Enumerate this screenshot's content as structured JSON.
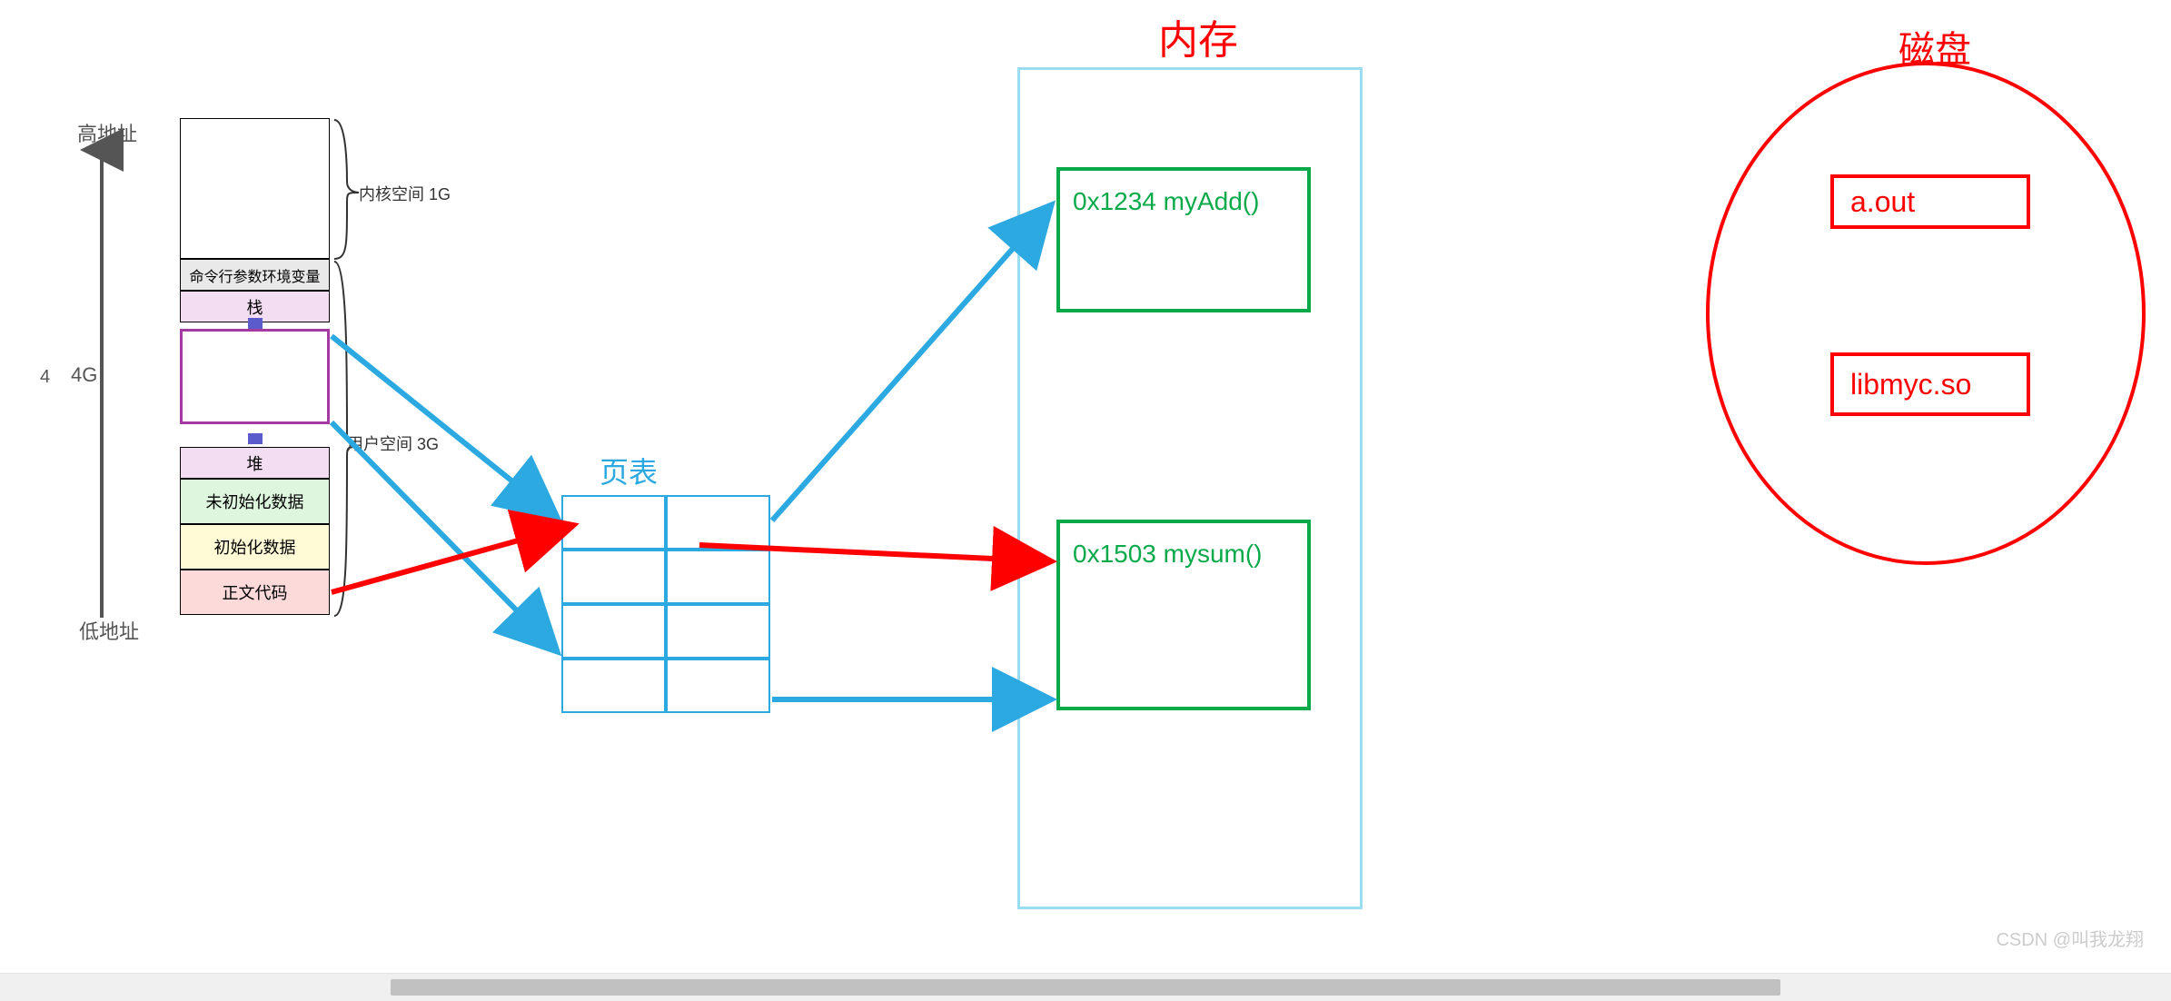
{
  "titles": {
    "memory": "内存",
    "disk": "磁盘",
    "page_table": "页表"
  },
  "address_labels": {
    "high": "高地址",
    "low": "低地址",
    "fourg": "4G",
    "four": "4"
  },
  "braces": {
    "kernel": "内核空间 1G",
    "user": "用户空间 3G"
  },
  "segments": {
    "cmdline": "命令行参数环境变量",
    "stack": "栈",
    "heap": "堆",
    "bss": "未初始化数据",
    "data": "初始化数据",
    "text": "正文代码"
  },
  "mem_boxes": {
    "addr1": "0x1234 myAdd()",
    "addr2": "0x1503 mysum()"
  },
  "disk_files": {
    "file1": "a.out",
    "file2": "libmyc.so"
  },
  "watermark": "CSDN @叫我龙翔"
}
